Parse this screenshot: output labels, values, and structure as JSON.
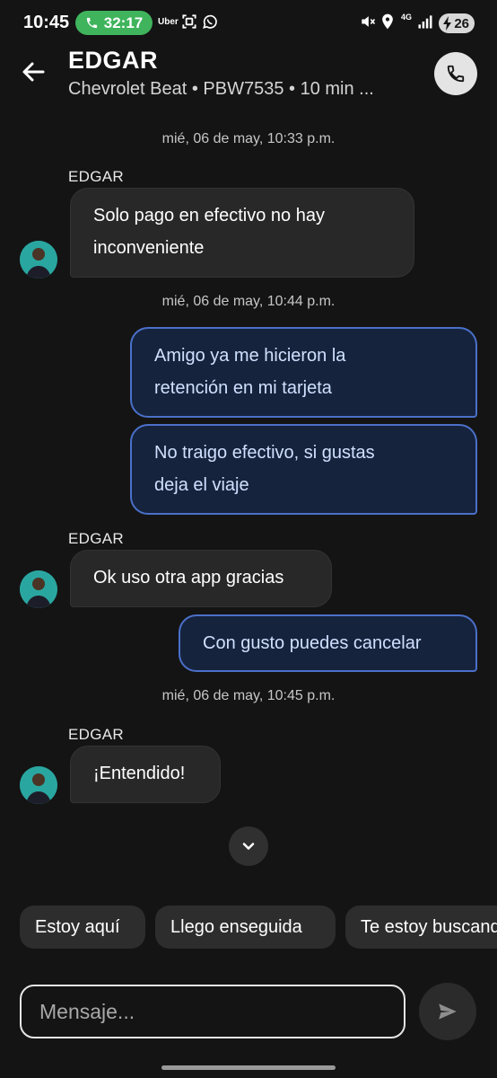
{
  "status_bar": {
    "time": "10:45",
    "call_duration": "32:17",
    "app_label": "Uber",
    "battery": "26",
    "network": "4G"
  },
  "header": {
    "title": "EDGAR",
    "subtitle": "Chevrolet Beat • PBW7535 • 10 min ..."
  },
  "messages": [
    {
      "type": "timestamp",
      "text": "mié, 06 de may, 10:33 p.m."
    },
    {
      "type": "sender",
      "text": "EDGAR"
    },
    {
      "type": "incoming",
      "lines": [
        "Solo pago en efectivo no hay",
        "inconveniente"
      ]
    },
    {
      "type": "timestamp",
      "text": "mié, 06 de may, 10:44 p.m."
    },
    {
      "type": "outgoing",
      "lines": [
        "Amigo ya me hicieron la",
        "retención en mi tarjeta"
      ]
    },
    {
      "type": "outgoing",
      "lines": [
        "No traigo efectivo, si gustas",
        "deja el viaje"
      ]
    },
    {
      "type": "sender",
      "text": "EDGAR"
    },
    {
      "type": "incoming",
      "lines": [
        "Ok uso otra app gracias"
      ]
    },
    {
      "type": "outgoing",
      "lines": [
        "Con gusto puedes cancelar"
      ]
    },
    {
      "type": "timestamp",
      "text": "mié, 06 de may, 10:45 p.m."
    },
    {
      "type": "sender",
      "text": "EDGAR"
    },
    {
      "type": "incoming",
      "lines": [
        "¡Entendido!"
      ]
    }
  ],
  "quick_replies": [
    "Estoy aquí",
    "Llego enseguida",
    "Te estoy buscando"
  ],
  "composer": {
    "placeholder": "Mensaje..."
  },
  "colors": {
    "background": "#141414",
    "incoming_bubble": "#282828",
    "outgoing_bubble": "#16233d",
    "outgoing_border": "#4a70c9",
    "call_pill": "#3fb45c"
  }
}
